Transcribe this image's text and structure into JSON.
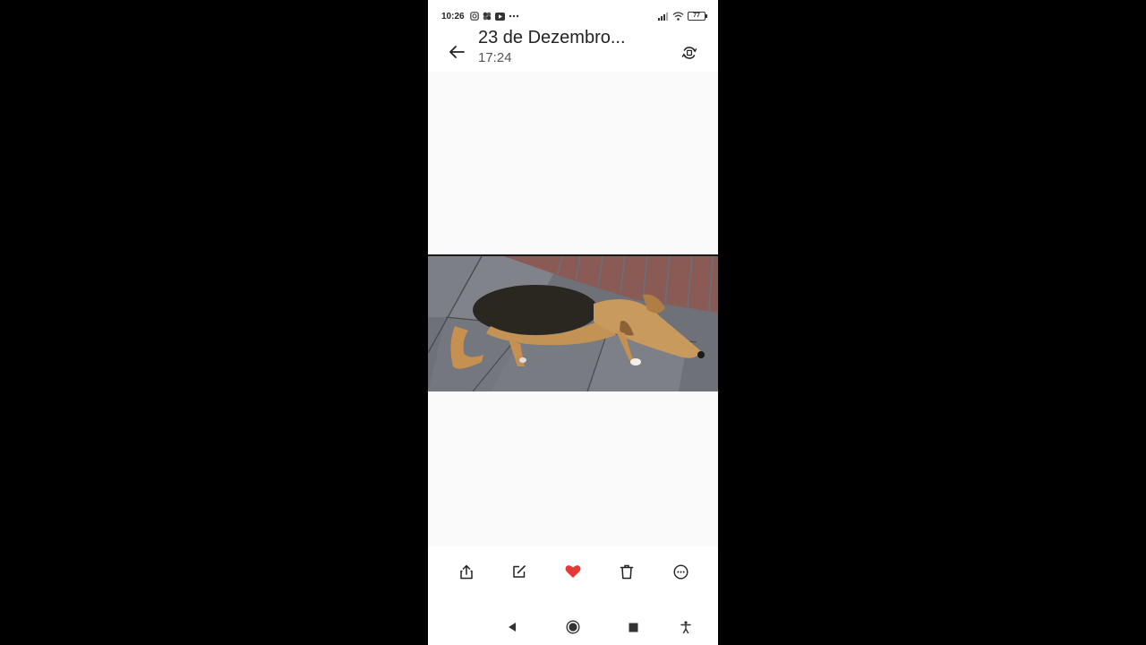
{
  "status_bar": {
    "time": "10:26",
    "battery": "77"
  },
  "header": {
    "title": "23 de Dezembro...",
    "subtitle": "17:24"
  },
  "photo": {
    "description_icon": "photo-dog-on-sidewalk"
  },
  "actions": [
    {
      "icon": "share-icon"
    },
    {
      "icon": "edit-icon"
    },
    {
      "icon": "heart-icon",
      "color": "#e53935"
    },
    {
      "icon": "trash-icon"
    },
    {
      "icon": "more-icon"
    }
  ],
  "colors": {
    "favorite": "#e53935",
    "background": "#fafafa"
  }
}
